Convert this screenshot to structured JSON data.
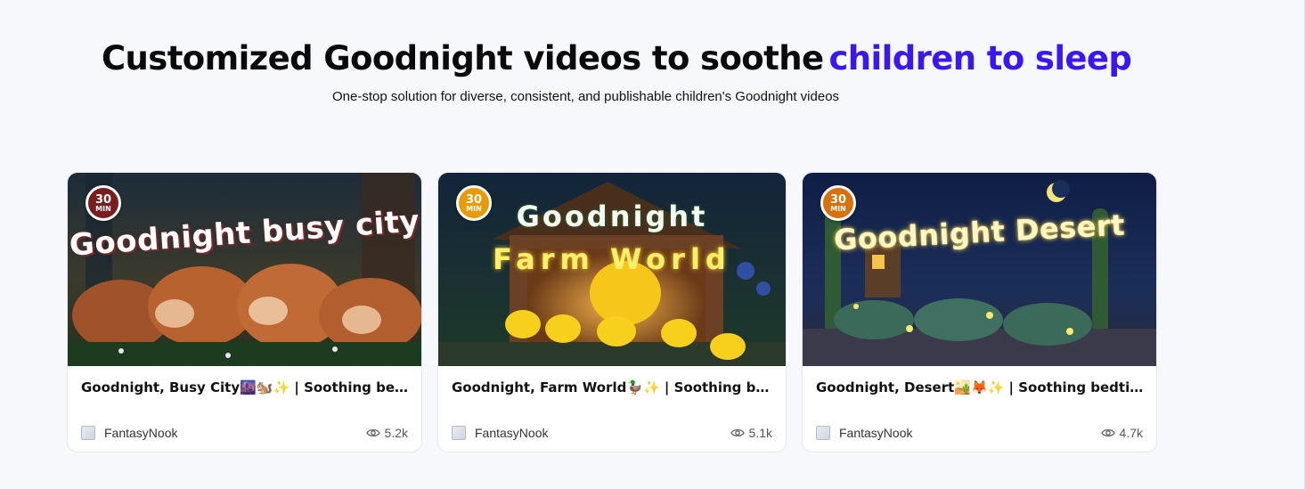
{
  "hero": {
    "headline_main": "Customized Goodnight videos to soothe",
    "headline_accent": "children to sleep",
    "subtitle": "One-stop solution for diverse, consistent, and publishable children's Goodnight videos",
    "accent_color": "#3c17f5"
  },
  "cards": [
    {
      "thumbnail_title": "Goodnight busy city",
      "badge_number": "30",
      "badge_unit": "MIN",
      "badge_color": "#7a1d1d",
      "title": "Goodnight, Busy City🌆🐿️✨ | Soothing bedtime",
      "author": "FantasyNook",
      "views": "5.2k",
      "avatar_icon": "broken-image-icon",
      "views_icon": "eye-icon"
    },
    {
      "thumbnail_title_line1": "Goodnight",
      "thumbnail_title_line2": "Farm World",
      "badge_number": "30",
      "badge_unit": "MIN",
      "badge_color": "#e89a07",
      "title": "Goodnight, Farm World🦆✨ | Soothing bedtime",
      "author": "FantasyNook",
      "views": "5.1k",
      "avatar_icon": "broken-image-icon",
      "views_icon": "eye-icon"
    },
    {
      "thumbnail_title": "Goodnight Desert",
      "badge_number": "30",
      "badge_unit": "MIN",
      "badge_color": "#d9700c",
      "title": "Goodnight, Desert🏜️🦊✨ | Soothing bedtime",
      "author": "FantasyNook",
      "views": "4.7k",
      "avatar_icon": "broken-image-icon",
      "views_icon": "eye-icon"
    }
  ]
}
